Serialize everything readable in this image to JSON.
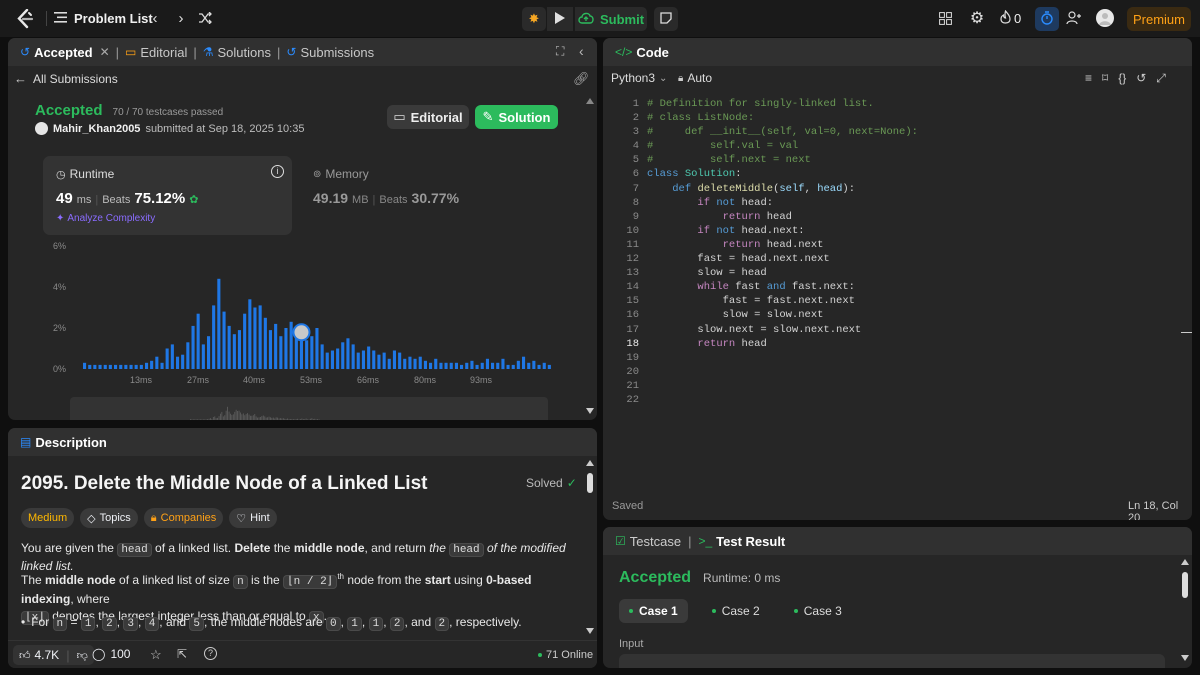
{
  "topbar": {
    "problem_list": "Problem List",
    "submit": "Submit",
    "streak_count": "0",
    "premium": "Premium"
  },
  "left_tabs": {
    "accepted": "Accepted",
    "editorial": "Editorial",
    "solutions": "Solutions",
    "submissions": "Submissions"
  },
  "submission": {
    "back": "All Submissions",
    "status": "Accepted",
    "testcases": "70 / 70 testcases passed",
    "user": "Mahir_Khan2005",
    "submitted_at": "submitted at Sep 18, 2025 10:35",
    "editorial_btn": "Editorial",
    "solution_btn": "Solution",
    "runtime_label": "Runtime",
    "runtime_value": "49",
    "runtime_unit": "ms",
    "runtime_beats_label": "Beats",
    "runtime_beats": "75.12%",
    "analyze": "Analyze Complexity",
    "memory_label": "Memory",
    "memory_value": "49.19",
    "memory_unit": "MB",
    "memory_beats_label": "Beats",
    "memory_beats": "30.77%"
  },
  "chart_data": {
    "type": "bar",
    "ylabels": [
      "6%",
      "4%",
      "2%",
      "0%"
    ],
    "xlabels": [
      "13ms",
      "27ms",
      "40ms",
      "53ms",
      "66ms",
      "80ms",
      "93ms"
    ],
    "values": [
      0.3,
      0.2,
      0.2,
      0.2,
      0.2,
      0.2,
      0.2,
      0.2,
      0.2,
      0.2,
      0.2,
      0.2,
      0.3,
      0.4,
      0.6,
      0.3,
      1.0,
      1.2,
      0.6,
      0.7,
      1.3,
      2.1,
      2.7,
      1.2,
      1.6,
      3.1,
      4.4,
      2.8,
      2.1,
      1.7,
      1.9,
      2.7,
      3.4,
      3.0,
      3.1,
      2.5,
      1.9,
      2.2,
      1.6,
      2.0,
      2.3,
      1.8,
      1.4,
      1.4,
      1.6,
      2.0,
      1.2,
      0.8,
      0.9,
      1.0,
      1.3,
      1.5,
      1.2,
      0.8,
      0.9,
      1.1,
      0.9,
      0.7,
      0.8,
      0.5,
      0.9,
      0.8,
      0.5,
      0.6,
      0.5,
      0.6,
      0.4,
      0.3,
      0.5,
      0.3,
      0.3,
      0.3,
      0.3,
      0.2,
      0.3,
      0.4,
      0.2,
      0.3,
      0.5,
      0.3,
      0.3,
      0.5,
      0.2,
      0.2,
      0.4,
      0.6,
      0.3,
      0.4,
      0.2,
      0.3,
      0.2
    ],
    "highlight_index": 42,
    "ylim": [
      0,
      6
    ]
  },
  "description": {
    "tab": "Description",
    "title": "2095. Delete the Middle Node of a Linked List",
    "solved": "Solved",
    "difficulty": "Medium",
    "topics": "Topics",
    "companies": "Companies",
    "hint": "Hint",
    "p1_a": "You are given the ",
    "p1_code1": "head",
    "p1_b": " of a linked list. ",
    "p1_c": "Delete",
    "p1_d": " the ",
    "p1_e": "middle node",
    "p1_f": ", and return ",
    "p1_g": "the ",
    "p1_code2": "head",
    "p1_h": " of the modified linked list.",
    "p2_a": "The ",
    "p2_b": "middle node",
    "p2_c": " of a linked list of size ",
    "p2_code1": "n",
    "p2_d": " is the ",
    "p2_code2": "⌊n / 2⌋",
    "p2_sup": "th",
    "p2_e": " node from the ",
    "p2_f": "start",
    "p2_g": " using ",
    "p2_h": "0-based indexing",
    "p2_i": ", where",
    "p2_code3": "⌊x⌋",
    "p2_j": " denotes the largest integer less than or equal to ",
    "p2_code4": "x",
    "p2_k": ".",
    "b_a": "For ",
    "b_n": "n",
    "b_eq": " = ",
    "b_v": [
      "1",
      "2",
      "3",
      "4"
    ],
    "b_and": ", and ",
    "b_v5": "5",
    "b_mid": ", the middle nodes are ",
    "b_m": [
      "0",
      "1",
      "1",
      "2"
    ],
    "b_and2": ", and ",
    "b_m5": "2",
    "b_end": ", respectively.",
    "likes": "4.7K",
    "comments": "100",
    "online": "71 Online"
  },
  "code": {
    "tab": "Code",
    "language": "Python3",
    "auto": "Auto",
    "saved": "Saved",
    "cursor": "Ln 18, Col 20",
    "line_numbers": [
      "1",
      "2",
      "3",
      "4",
      "5",
      "6",
      "7",
      "8",
      "9",
      "10",
      "11",
      "12",
      "13",
      "14",
      "15",
      "16",
      "17",
      "18",
      "19",
      "20",
      "21",
      "22"
    ]
  },
  "result": {
    "testcase_tab": "Testcase",
    "result_tab": "Test Result",
    "status": "Accepted",
    "runtime": "Runtime: 0 ms",
    "cases": [
      "Case 1",
      "Case 2",
      "Case 3"
    ],
    "input_label": "Input"
  },
  "colors": {
    "accent_green": "#2cbb5d",
    "accent_blue": "#2b7de9",
    "premium": "#ffa116",
    "bar": "#1f77e5"
  }
}
